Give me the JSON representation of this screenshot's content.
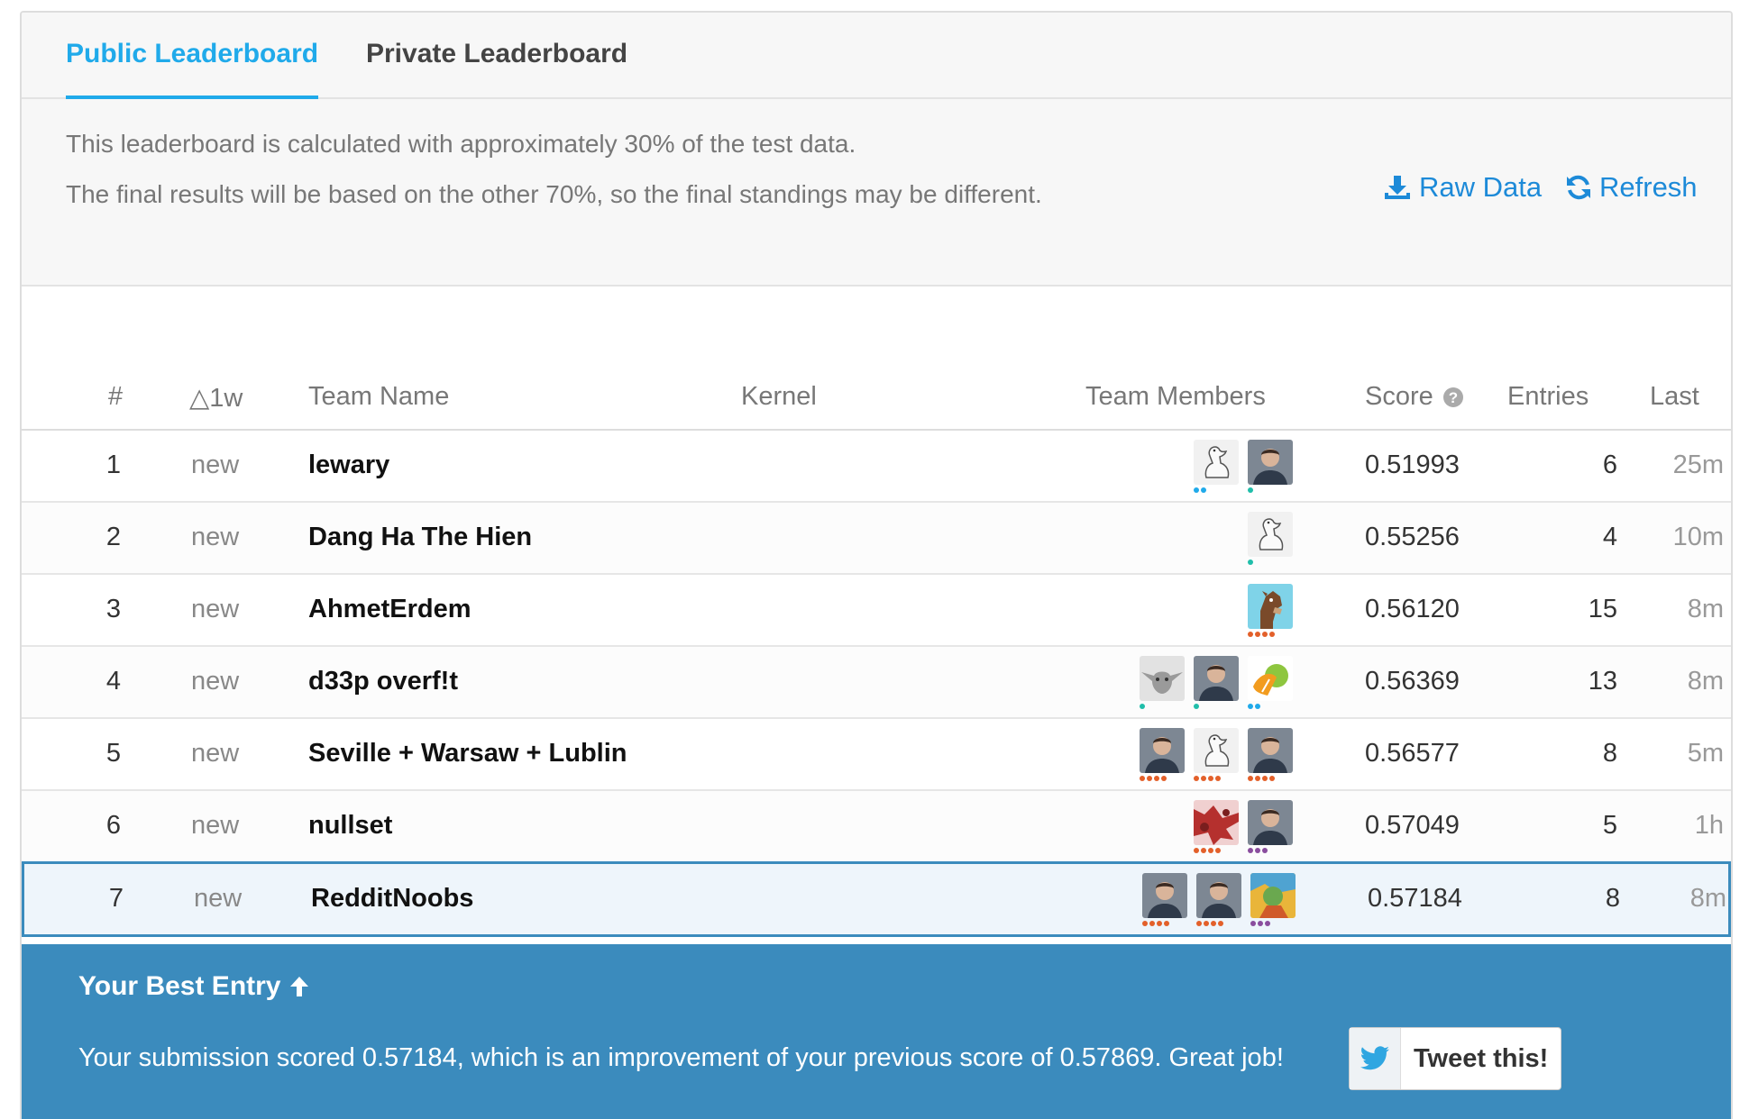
{
  "tabs": [
    {
      "label": "Public Leaderboard",
      "active": true
    },
    {
      "label": "Private Leaderboard",
      "active": false
    }
  ],
  "notice": {
    "line1": "This leaderboard is calculated with approximately 30% of the test data.",
    "line2": "The final results will be based on the other 70%, so the final standings may be different."
  },
  "actions": {
    "raw_data": "Raw Data",
    "refresh": "Refresh"
  },
  "columns": {
    "rank": "#",
    "delta": "△1w",
    "team": "Team Name",
    "kernel": "Kernel",
    "members": "Team Members",
    "score": "Score",
    "entries": "Entries",
    "last": "Last"
  },
  "rows": [
    {
      "rank": "1",
      "delta": "new",
      "team": "lewary",
      "score": "0.51993",
      "entries": "6",
      "last": "25m",
      "members": [
        {
          "avatar": "goose-icon",
          "tier_color": "#20aaea",
          "tier_dots": 2
        },
        {
          "avatar": "man-photo",
          "tier_color": "#20beaa",
          "tier_dots": 1
        }
      ]
    },
    {
      "rank": "2",
      "delta": "new",
      "team": "Dang Ha The Hien",
      "score": "0.55256",
      "entries": "4",
      "last": "10m",
      "members": [
        {
          "avatar": "goose-icon",
          "tier_color": "#20beaa",
          "tier_dots": 1
        }
      ]
    },
    {
      "rank": "3",
      "delta": "new",
      "team": "AhmetErdem",
      "score": "0.56120",
      "entries": "15",
      "last": "8m",
      "members": [
        {
          "avatar": "horse-cartoon",
          "tier_color": "#e3602a",
          "tier_dots": 4
        }
      ]
    },
    {
      "rank": "4",
      "delta": "new",
      "team": "d33p overf!t",
      "score": "0.56369",
      "entries": "13",
      "last": "8m",
      "members": [
        {
          "avatar": "yoda-photo",
          "tier_color": "#20beaa",
          "tier_dots": 1
        },
        {
          "avatar": "man-photo",
          "tier_color": "#20beaa",
          "tier_dots": 1
        },
        {
          "avatar": "fruit-photo",
          "tier_color": "#20aaea",
          "tier_dots": 2
        }
      ]
    },
    {
      "rank": "5",
      "delta": "new",
      "team": "Seville + Warsaw + Lublin",
      "score": "0.56577",
      "entries": "8",
      "last": "5m",
      "members": [
        {
          "avatar": "man-photo",
          "tier_color": "#e3602a",
          "tier_dots": 4
        },
        {
          "avatar": "goose-icon",
          "tier_color": "#e3602a",
          "tier_dots": 4
        },
        {
          "avatar": "man-photo",
          "tier_color": "#e3602a",
          "tier_dots": 4
        }
      ]
    },
    {
      "rank": "6",
      "delta": "new",
      "team": "nullset",
      "score": "0.57049",
      "entries": "5",
      "last": "1h",
      "members": [
        {
          "avatar": "pattern-photo",
          "tier_color": "#e3602a",
          "tier_dots": 4
        },
        {
          "avatar": "man-photo",
          "tier_color": "#8a4d9e",
          "tier_dots": 3
        }
      ]
    },
    {
      "rank": "7",
      "delta": "new",
      "team": "RedditNoobs",
      "score": "0.57184",
      "entries": "8",
      "last": "8m",
      "mine": true,
      "members": [
        {
          "avatar": "man-photo",
          "tier_color": "#e3602a",
          "tier_dots": 4
        },
        {
          "avatar": "man-photo",
          "tier_color": "#e3602a",
          "tier_dots": 4
        },
        {
          "avatar": "art-photo",
          "tier_color": "#8a4d9e",
          "tier_dots": 3
        }
      ]
    }
  ],
  "best_entry": {
    "title": "Your Best Entry",
    "message": "Your submission scored 0.57184, which is an improvement of your previous score of 0.57869. Great job!",
    "tweet_label": "Tweet this!"
  },
  "colors": {
    "accent": "#20aaea",
    "link": "#1d8ad8",
    "banner": "#3b8bbd"
  }
}
